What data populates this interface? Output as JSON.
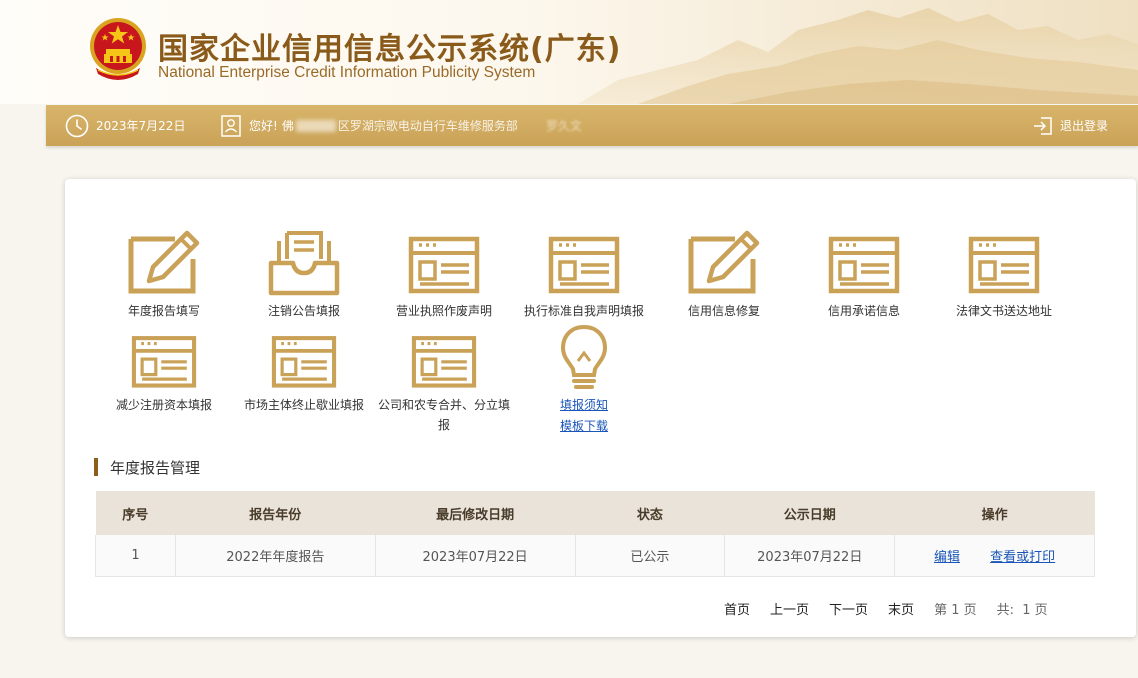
{
  "header": {
    "title_cn": "国家企业信用信息公示系统(广东)",
    "title_en": "National Enterprise Credit Information Publicity System"
  },
  "topbar": {
    "date": "2023年7月22日",
    "greeting": "您好!",
    "greeting_visible_name": "佛",
    "greeting_visible_company": "区罗湖宗歌电动自行车维修服务部",
    "greeting_visible_person": "罗久文",
    "logout": "退出登录"
  },
  "functions": [
    {
      "label": "年度报告填写",
      "icon": "pencil-edit-icon"
    },
    {
      "label": "注销公告填报",
      "icon": "inbox-document-icon"
    },
    {
      "label": "营业执照作废声明",
      "icon": "form-window-icon"
    },
    {
      "label": "执行标准自我声明填报",
      "icon": "form-window-icon"
    },
    {
      "label": "信用信息修复",
      "icon": "pencil-edit-icon"
    },
    {
      "label": "信用承诺信息",
      "icon": "form-window-icon"
    },
    {
      "label": "法律文书送达地址",
      "icon": "form-window-icon"
    },
    {
      "label": "减少注册资本填报",
      "icon": "form-window-icon"
    },
    {
      "label": "市场主体终止歇业填报",
      "icon": "form-window-icon"
    },
    {
      "label": "公司和农专合并、分立填报",
      "icon": "form-window-icon"
    }
  ],
  "links": {
    "icon": "lightbulb-icon",
    "notice": "填报须知",
    "template": "模板下载"
  },
  "section": {
    "title": "年度报告管理"
  },
  "table": {
    "headers": [
      "序号",
      "报告年份",
      "最后修改日期",
      "状态",
      "公示日期",
      "操作"
    ],
    "rows": [
      {
        "index": "1",
        "year": "2022年年度报告",
        "modified": "2023年07月22日",
        "status": "已公示",
        "publish_date": "2023年07月22日",
        "action_edit": "编辑",
        "action_view": "查看或打印"
      }
    ]
  },
  "pager": {
    "first": "首页",
    "prev": "上一页",
    "next": "下一页",
    "last": "末页",
    "current": "第 1 页",
    "total": "共:  1 页"
  },
  "colors": {
    "gold": "#c9a157",
    "brown": "#8a5a1a",
    "link": "#1a56b8"
  }
}
